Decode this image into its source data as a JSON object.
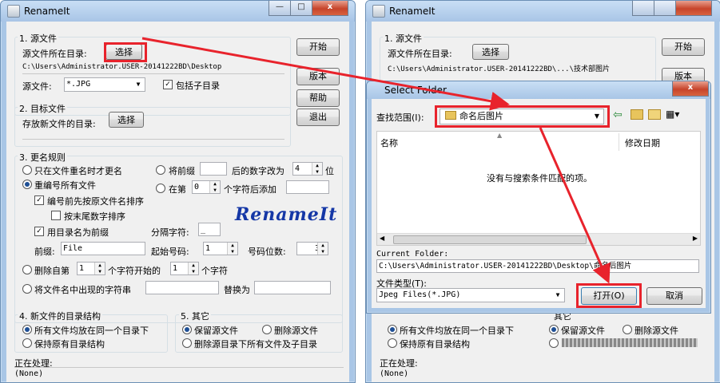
{
  "left_window": {
    "title": "RenameIt",
    "controls": {
      "minimize": "—",
      "maximize": "□",
      "close": "x"
    },
    "source": {
      "group": "1. 源文件",
      "dir_label": "源文件所在目录:",
      "select_btn": "选择",
      "path": "C:\\Users\\Administrator.USER-20141222BD\\Desktop",
      "filter_label": "源文件:",
      "filter_value": "*.JPG",
      "include_sub": "包括子目录"
    },
    "target": {
      "group": "2. 目标文件",
      "dir_label": "存放新文件的目录:",
      "select_btn": "选择"
    },
    "side_buttons": {
      "start": "开始",
      "version": "版本",
      "help": "帮助",
      "exit": "退出"
    },
    "rules": {
      "group": "3. 更名规则",
      "rename_only_when": "只在文件重名时才更名",
      "renumber_all": "重编号所有文件",
      "sort_by_name": "编号前先按原文件名排序",
      "sort_by_tail": "按末尾数字排序",
      "use_dir_prefix": "用目录名为前缀",
      "prefix_label": "前缀:",
      "prefix_value": "File",
      "prefix_number_text_a": "将前缀",
      "prefix_number_text_b": "后的数字改为",
      "prefix_number_value": "4",
      "prefix_number_text_c": "位",
      "insert_text_a": "在第",
      "insert_value": "0",
      "insert_text_b": "个字符后添加",
      "separator_label": "分隔字符:",
      "separator_value": "_",
      "start_label": "起始号码:",
      "start_value": "1",
      "digits_label": "号码位数:",
      "digits_value": "3",
      "delete_text_a": "删除自第",
      "delete_from": "1",
      "delete_text_b": "个字符开始的",
      "delete_count": "1",
      "delete_text_c": "个字符",
      "replace_text_a": "将文件名中出现的字符串",
      "replace_text_b": "替换为",
      "logo": "RenameIt"
    },
    "dir_structure": {
      "group": "4. 新文件的目录结构",
      "same_dir": "所有文件均放在同一个目录下",
      "keep_dir": "保持原有目录结构"
    },
    "other": {
      "group": "5. 其它",
      "keep_source": "保留源文件",
      "delete_source": "删除源文件",
      "delete_all_sub": "删除源目录下所有文件及子目录"
    },
    "processing_label": "正在处理:",
    "processing_value": "(None)"
  },
  "right_window": {
    "title": "RenameIt",
    "source_group": "1. 源文件",
    "dir_label": "源文件所在目录:",
    "select_btn": "选择",
    "path": "C:\\Users\\Administrator.USER-20141222BD\\...\\技术部图片",
    "start_btn": "开始",
    "version_btn": "版本",
    "same_dir": "所有文件均放在同一个目录下",
    "keep_dir": "保持原有目录结构",
    "keep_source": "保留源文件",
    "delete_source": "删除源文件",
    "other_group": "其它",
    "processing_label": "正在处理:",
    "processing_value": "(None)"
  },
  "dialog": {
    "title": "Select Folder",
    "look_in_label": "查找范围(I):",
    "look_in_value": "命名后图片",
    "col_name": "名称",
    "col_date": "修改日期",
    "empty_msg": "没有与搜索条件匹配的项。",
    "current_folder_label": "Current Folder:",
    "current_folder_value": "C:\\Users\\Administrator.USER-20141222BD\\Desktop\\命名后图片",
    "file_type_label": "文件类型(T):",
    "file_type_value": "Jpeg Files(*.JPG)",
    "open_btn": "打开(O)",
    "cancel_btn": "取消"
  },
  "colors": {
    "highlight": "#e8232c",
    "title_blue": "#a8c5e6",
    "logo_blue": "#1537a6"
  }
}
